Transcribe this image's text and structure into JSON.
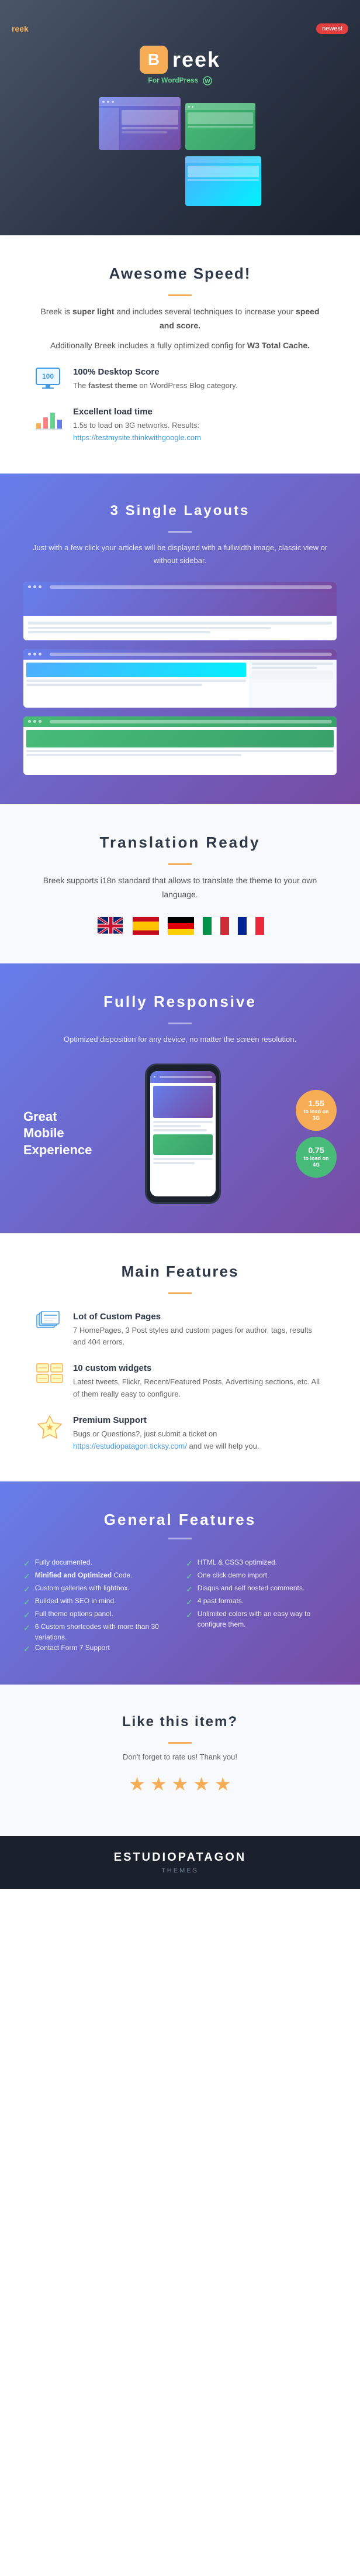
{
  "hero": {
    "brand": "reek",
    "badge_label": "newest",
    "logo_letter": "B",
    "logo_name": "reek",
    "for_label": "For",
    "wp_label": "WordPress"
  },
  "speed": {
    "title": "Awesome Speed!",
    "description_1": "Breek is super light and includes several techniques to increase your speed and score.",
    "description_2": "Additionally Breek includes a fully optimized config for W3 Total Cache.",
    "feature1_title": "100% Desktop Score",
    "feature1_desc": "The fastest theme on WordPress Blog category.",
    "feature2_title": "Excellent load time",
    "feature2_desc": "1.5s to load on 3G networks. Results: https://testmysite.thinkwithgoogle.com"
  },
  "layouts": {
    "title": "3 Single Layouts",
    "description": "Just with a few click your articles will be displayed with a fullwidth image, classic view or without sidebar."
  },
  "translation": {
    "title": "Translation Ready",
    "description": "Breek supports i18n standard that allows to translate the theme to your own language."
  },
  "responsive": {
    "title": "Fully Responsive",
    "description": "Optimized disposition for any device, no matter the screen resolution.",
    "mobile_label": "Great Mobile Experience",
    "badge1_text": "Just 1.55 to load on 3G",
    "badge1_num": "1.55",
    "badge1_unit": "to load on 3G",
    "badge2_text": "Just 0.75 to load on 4G",
    "badge2_num": "0.75",
    "badge2_unit": "to load on 4G"
  },
  "main_features": {
    "title": "Main Features",
    "feature1_title": "Lot of Custom Pages",
    "feature1_desc": "7 HomePages, 3 Post styles and custom pages for author, tags, results and 404 errors.",
    "feature2_title": "10 custom widgets",
    "feature2_desc": "Latest tweets, Flickr, Recent/Featured Posts, Advertising sections, etc. All of them really easy to configure.",
    "feature3_title": "Premium Support",
    "feature3_desc": "Bugs or Questions?, just submit a ticket on https://estudiopatagon.ticksy.com/ and we will help you."
  },
  "general_features": {
    "title": "General Features",
    "left_items": [
      "Fully documented.",
      "Minified and Optimized Code.",
      "Custom galleries with lightbox.",
      "Builded with SEO in mind.",
      "Full theme options panel.",
      "6 Custom shortcodes with more than 30 variations.",
      "Contact Form 7 Support"
    ],
    "right_items": [
      "HTML & CSS3 optimized.",
      "One click demo import.",
      "Disqus and self hosted comments.",
      "4 post formats.",
      "Unlimited colors with an easy way to configure them."
    ]
  },
  "like": {
    "title": "Like this item?",
    "subtitle": "Don't forget to rate us! Thank you!",
    "stars": [
      "★",
      "★",
      "★",
      "★",
      "★"
    ]
  },
  "footer": {
    "brand": "ESTUDIOPATAGON",
    "tagline": "THEMES"
  }
}
